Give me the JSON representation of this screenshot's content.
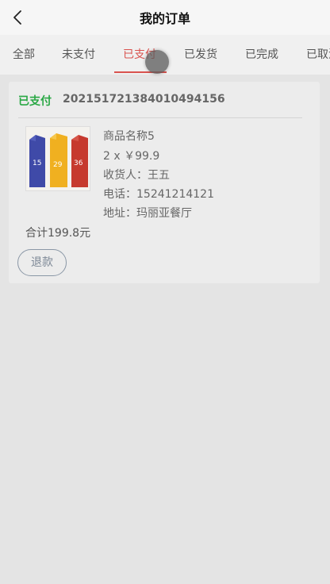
{
  "header": {
    "title": "我的订单",
    "back_icon": "chevron-left-icon"
  },
  "tabs": [
    {
      "label": "全部"
    },
    {
      "label": "未支付"
    },
    {
      "label": "已支付"
    },
    {
      "label": "已发货"
    },
    {
      "label": "已完成"
    },
    {
      "label": "已取消"
    }
  ],
  "active_tab": "已支付",
  "order": {
    "status": "已支付",
    "number": "20215172138401049415​6",
    "product_name": "商品名称5",
    "quantity_price": "2 x ￥99.9",
    "recipient": "收货人：王五",
    "phone": "电话：15241214121",
    "address": "地址：玛丽亚餐厅",
    "total": "合计199.8元",
    "refund_label": "退款",
    "image_digits": [
      "15",
      "29",
      "36"
    ]
  },
  "colors": {
    "accent": "#d9534f",
    "status_green": "#2aa845",
    "box_blue": "#3f4aa8",
    "box_yellow": "#f0b020",
    "box_red": "#c63a2e"
  }
}
